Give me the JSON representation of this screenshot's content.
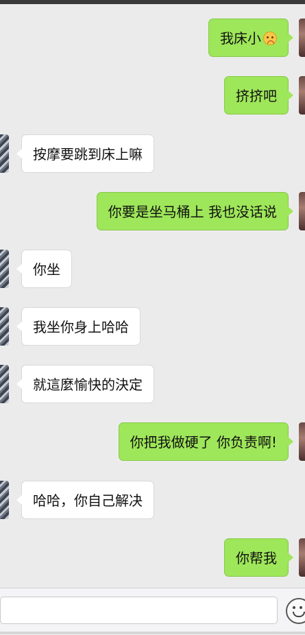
{
  "messages": [
    {
      "side": "me",
      "text": "我床小",
      "emoji": "pouting-face"
    },
    {
      "side": "me",
      "text": "挤挤吧"
    },
    {
      "side": "them",
      "text": "按摩要跳到床上嘛"
    },
    {
      "side": "me",
      "text": "你要是坐马桶上 我也没话说"
    },
    {
      "side": "them",
      "text": "你坐"
    },
    {
      "side": "them",
      "text": "我坐你身上哈哈"
    },
    {
      "side": "them",
      "text": "就這麼愉快的決定"
    },
    {
      "side": "me",
      "text": "你把我做硬了 你负责啊!"
    },
    {
      "side": "them",
      "text": "哈哈，你自己解决"
    },
    {
      "side": "me",
      "text": "你帮我"
    }
  ],
  "input": {
    "value": "",
    "placeholder": ""
  },
  "colors": {
    "background": "#ebebeb",
    "my_bubble": "#9ee65a",
    "their_bubble": "#ffffff"
  },
  "icons": {
    "emoji_button": "smiley-face-icon"
  }
}
